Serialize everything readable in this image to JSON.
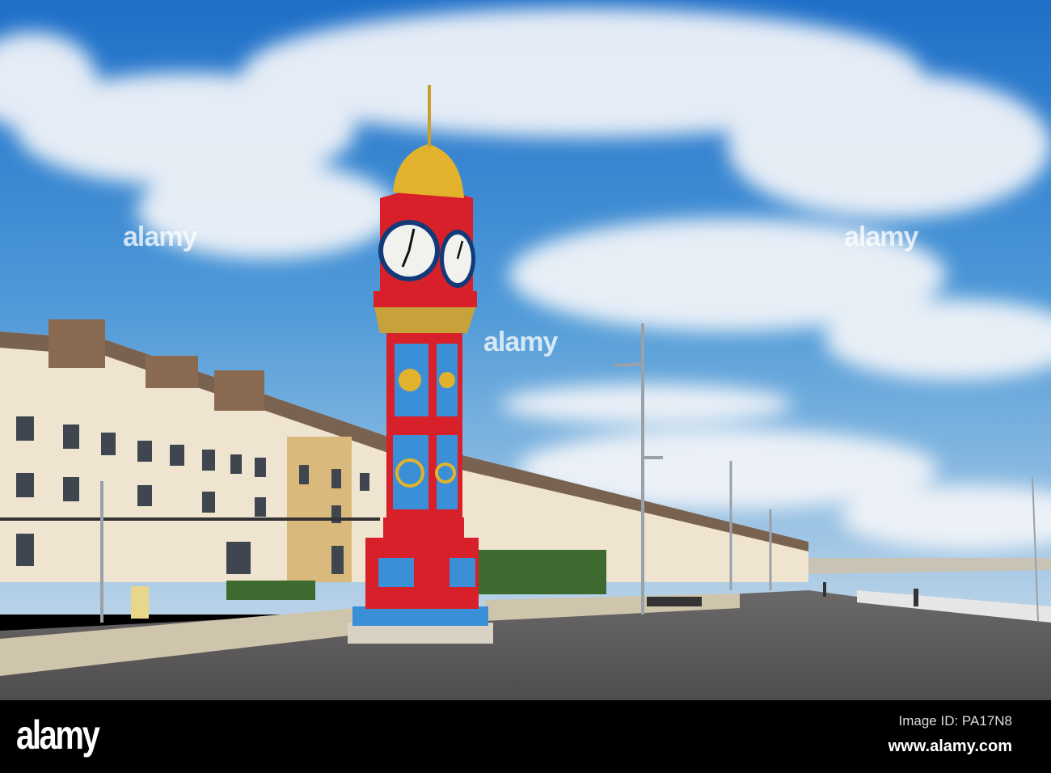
{
  "watermark": {
    "logo_text": "alamy",
    "image_id": "Image ID: PA17N8",
    "website": "www.alamy.com",
    "overlay_text": "alamy"
  },
  "colors": {
    "sky": "#2f7fd0",
    "tower_red": "#d8202a",
    "tower_blue": "#3a8fd6",
    "gold": "#e3b22c",
    "pavement": "#5c5a5a",
    "buildings": "#efe4cf"
  }
}
